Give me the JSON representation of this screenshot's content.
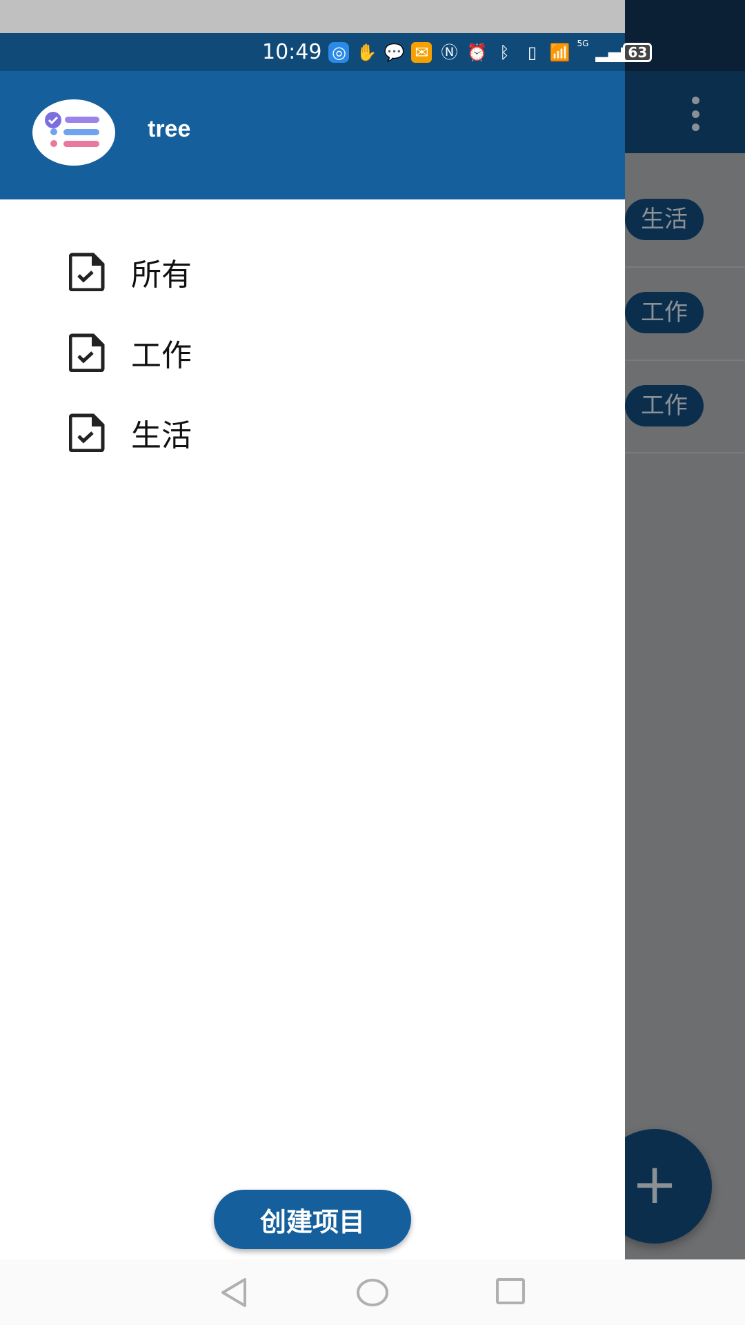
{
  "status_bar": {
    "time": "10:49",
    "network": "5G",
    "battery": "63"
  },
  "drawer": {
    "app_name": "tree",
    "items": [
      {
        "label": "所有",
        "icon": "document-check-icon"
      },
      {
        "label": "工作",
        "icon": "document-check-icon"
      },
      {
        "label": "生活",
        "icon": "document-check-icon"
      }
    ],
    "create_button": "创建项目"
  },
  "background": {
    "chips": [
      "生活",
      "工作",
      "工作"
    ],
    "fab_label": "+"
  },
  "colors": {
    "primary": "#15609c",
    "status_bar": "#0f4a79"
  }
}
